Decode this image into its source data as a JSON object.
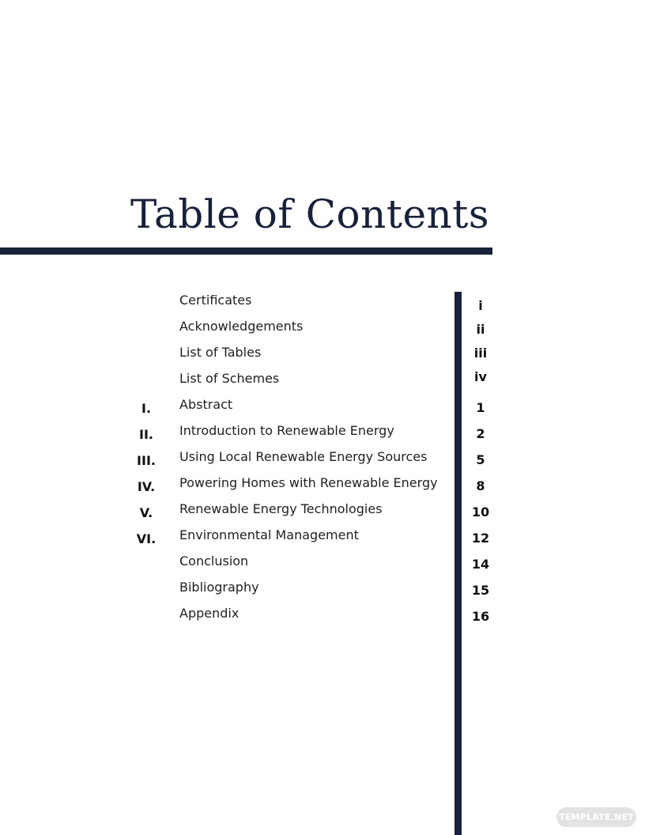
{
  "title": "Table of Contents",
  "accent_color": "#17213a",
  "entries": [
    {
      "numeral": "",
      "label": "Certificates",
      "page": "i"
    },
    {
      "numeral": "",
      "label": "Acknowledgements",
      "page": "ii"
    },
    {
      "numeral": "",
      "label": "List of Tables",
      "page": "iii"
    },
    {
      "numeral": "",
      "label": "List of Schemes",
      "page": "iv"
    },
    {
      "numeral": "I.",
      "label": "Abstract",
      "page": "1"
    },
    {
      "numeral": "II.",
      "label": "Introduction to Renewable Energy",
      "page": "2"
    },
    {
      "numeral": "III.",
      "label": "Using Local Renewable Energy Sources",
      "page": "5"
    },
    {
      "numeral": "IV.",
      "label": "Powering Homes with Renewable Energy",
      "page": "8"
    },
    {
      "numeral": "V.",
      "label": "Renewable Energy Technologies",
      "page": "10"
    },
    {
      "numeral": "VI.",
      "label": "Environmental Management",
      "page": "12"
    },
    {
      "numeral": "",
      "label": "Conclusion",
      "page": "14"
    },
    {
      "numeral": "",
      "label": "Bibliography",
      "page": "15"
    },
    {
      "numeral": "",
      "label": "Appendix",
      "page": "16"
    }
  ],
  "watermark": "TEMPLATE.NET"
}
